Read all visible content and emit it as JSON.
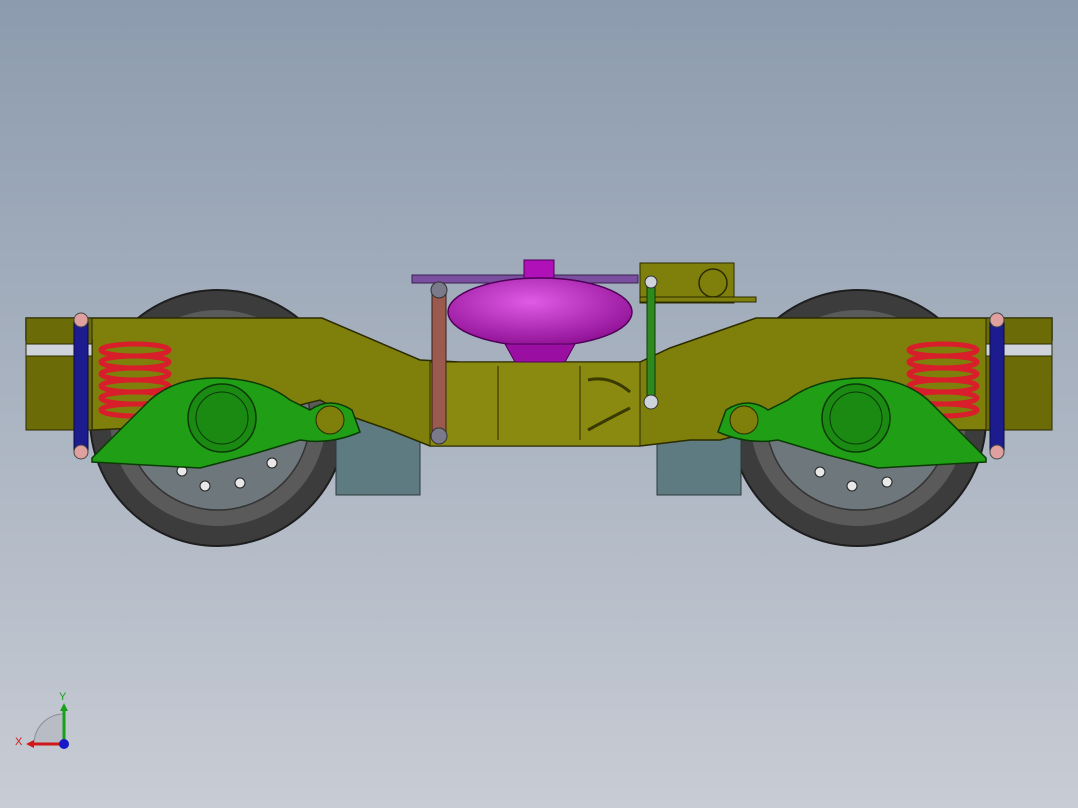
{
  "viewport": {
    "background_top": "#8c9bae",
    "background_bottom": "#c8ccd4"
  },
  "model": {
    "colors": {
      "frame": "#7f7f0c",
      "frame_dark": "#5d5d06",
      "axle_box": "#1f9e16",
      "spring": "#d81e2a",
      "damper": "#1c1c8e",
      "air_spring": "#c014c8",
      "wheel": "#454545",
      "brake_disc": "#5f6a70",
      "traction_rod": "#9a5a4e",
      "link": "#2f8a1e",
      "transom_block": "#5d7b80"
    }
  },
  "triad": {
    "x_label": "X",
    "y_label": "Y",
    "x_color": "#d01818",
    "y_color": "#18a018",
    "z_color": "#1818c8"
  }
}
